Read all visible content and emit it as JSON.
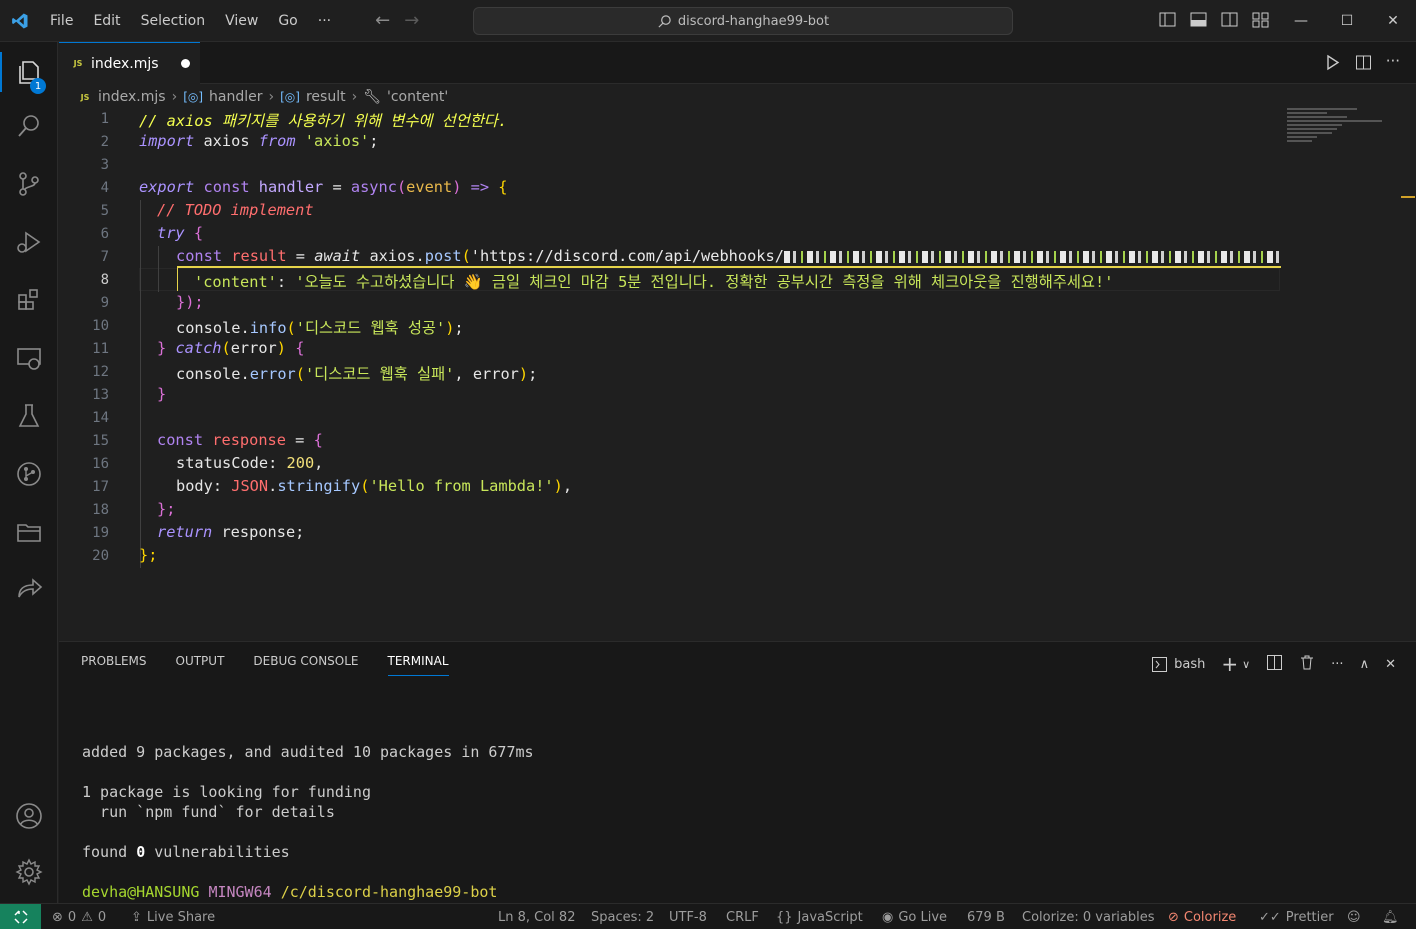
{
  "titlebar": {
    "menu": [
      "File",
      "Edit",
      "Selection",
      "View",
      "Go",
      "···"
    ],
    "search_text": "discord-hanghae99-bot"
  },
  "activity": {
    "explorer_badge": "1"
  },
  "tab": {
    "filename": "index.mjs",
    "icon_text": "JS"
  },
  "breadcrumb": {
    "file": "index.mjs",
    "item1": "handler",
    "item2": "result",
    "item3": "'content'"
  },
  "code": {
    "line_numbers": [
      "1",
      "2",
      "3",
      "4",
      "5",
      "6",
      "7",
      "8",
      "9",
      "10",
      "11",
      "12",
      "13",
      "14",
      "15",
      "16",
      "17",
      "18",
      "19",
      "20"
    ],
    "l1": "// axios 패키지를 사용하기 위해 변수에 선언한다.",
    "l2_kw": "import",
    "l2_a": " axios ",
    "l2_from": "from",
    "l2_str": "'axios'",
    "l2_end": ";",
    "l4_export": "export",
    "l4_const": "const",
    "l4_name": "handler",
    "l4_eq": " = ",
    "l4_async": "async",
    "l4_paren_open": "(",
    "l4_arg": "event",
    "l4_paren_close": ")",
    "l4_arrow": " => ",
    "l4_brace": "{",
    "l5": "// TODO implement",
    "l6_try": "try",
    "l6_brace": "{",
    "l7_const": "const",
    "l7_var": "result",
    "l7_eq": " = ",
    "l7_await": "await",
    "l7_obj": " axios",
    "l7_dot": ".",
    "l7_method": "post",
    "l7_paren": "(",
    "l7_url": "'https://discord.com/api/webhooks/",
    "l8_key": "'content'",
    "l8_colon": ": ",
    "l8_value": "'오늘도 수고하셨습니다 👋 금일 체크인 마감 5분 전입니다. 정확한 공부시간 측정을 위해 체크아웃을 진행해주세요!'",
    "l9": "});",
    "l10_obj": "console",
    "l10_method": "info",
    "l10_str": "'디스코드 웹훅 성공'",
    "l11_catch": "catch",
    "l11_arg": "error",
    "l12_obj": "console",
    "l12_method": "error",
    "l12_str": "'디스코드 웹훅 실패'",
    "l12_arg": "error",
    "l15_const": "const",
    "l15_var": "response",
    "l16_key": "statusCode",
    "l16_val": "200",
    "l17_key": "body",
    "l17_obj": "JSON",
    "l17_method": "stringify",
    "l17_str": "'Hello from Lambda!'",
    "l19_return": "return",
    "l19_var": " response;"
  },
  "panel": {
    "tabs": [
      "PROBLEMS",
      "OUTPUT",
      "DEBUG CONSOLE",
      "TERMINAL"
    ],
    "shell_label": "bash",
    "terminal": {
      "line1": "added 9 packages, and audited 10 packages in 677ms",
      "line2": "1 package is looking for funding",
      "line3": "  run `npm fund` for details",
      "line4_a": "found ",
      "line4_b": "0",
      "line4_c": " vulnerabilities",
      "prompt_user": "devha@HANSUNG",
      "prompt_env": "MINGW64",
      "prompt_path": "/c/discord-hanghae99-bot",
      "prompt_symbol": "$ "
    }
  },
  "status": {
    "errors": "0",
    "warnings": "0",
    "live_share": "Live Share",
    "position": "Ln 8, Col 82",
    "spaces": "Spaces: 2",
    "encoding": "UTF-8",
    "eol": "CRLF",
    "language": "JavaScript",
    "go_live": "Go Live",
    "size": "679 B",
    "colorize_vars": "Colorize: 0 variables",
    "colorize": "Colorize",
    "prettier": "Prettier"
  }
}
